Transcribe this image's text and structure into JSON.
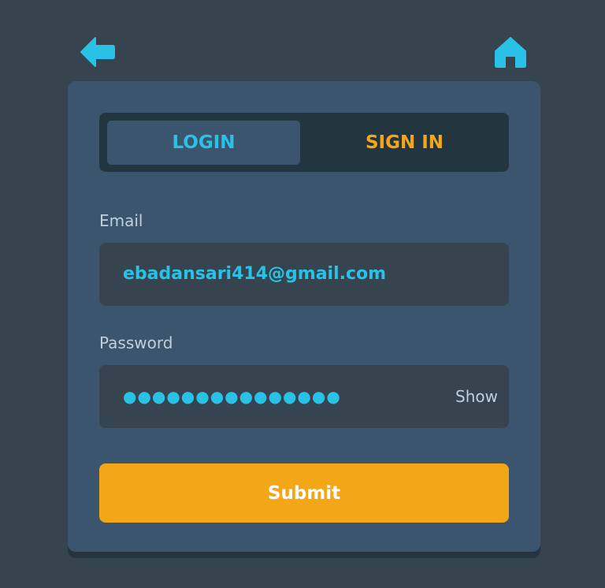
{
  "nav": {
    "back_icon": "arrow-left-icon",
    "home_icon": "home-icon"
  },
  "tabs": [
    {
      "label": "LOGIN",
      "active": true
    },
    {
      "label": "SIGN IN",
      "active": false
    }
  ],
  "form": {
    "email_label": "Email",
    "email_value": "ebadansari414@gmail.com",
    "password_label": "Password",
    "password_value": "●●●●●●●●●●●●●●●",
    "show_label": "Show",
    "submit_label": "Submit"
  },
  "colors": {
    "accent": "#29c2e6",
    "secondary_accent": "#f2a618",
    "background": "#35444f",
    "card": "#3b556f",
    "tab_bar": "#233640",
    "label_text": "#bfcfdb",
    "button_text": "#ffffff"
  }
}
